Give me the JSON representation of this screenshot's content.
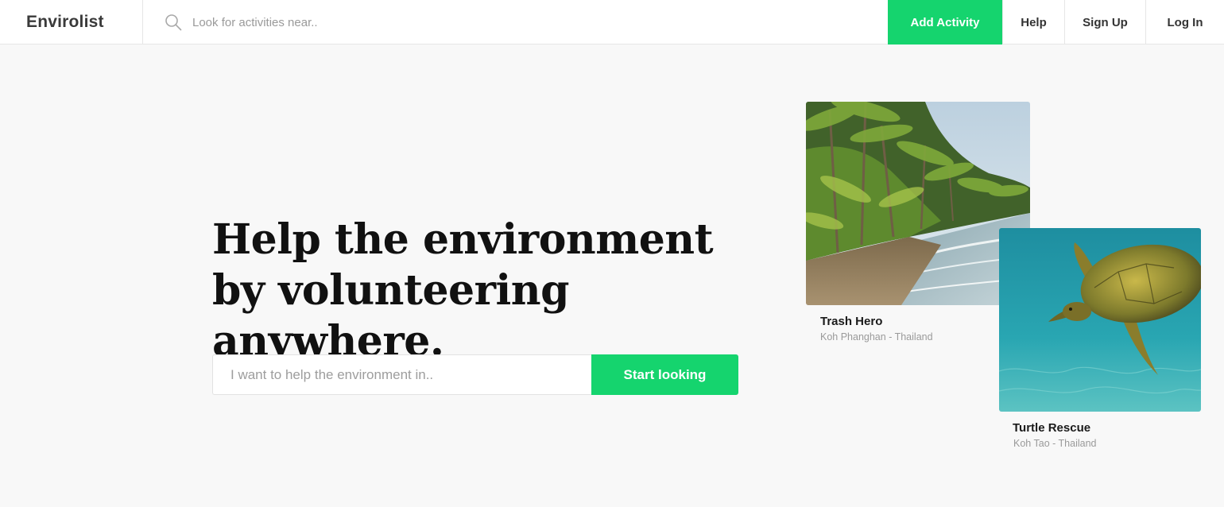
{
  "nav": {
    "brand": "Envirolist",
    "search_placeholder": "Look for activities near..",
    "add_activity": "Add Activity",
    "help": "Help",
    "sign_up": "Sign Up",
    "log_in": "Log In"
  },
  "hero": {
    "title": "Help the environment by volunteering anywhere.",
    "search_placeholder": "I want to help the environment in..",
    "button_label": "Start looking"
  },
  "cards": [
    {
      "title": "Trash Hero",
      "location": "Koh Phanghan - Thailand",
      "image": "tropical beach with palm trees"
    },
    {
      "title": "Turtle Rescue",
      "location": "Koh Tao - Thailand",
      "image": "sea turtle swimming underwater"
    }
  ],
  "colors": {
    "accent": "#15d46e",
    "background": "#f8f8f8",
    "nav_background": "#ffffff"
  },
  "icons": {
    "nav_search": "search-icon"
  }
}
